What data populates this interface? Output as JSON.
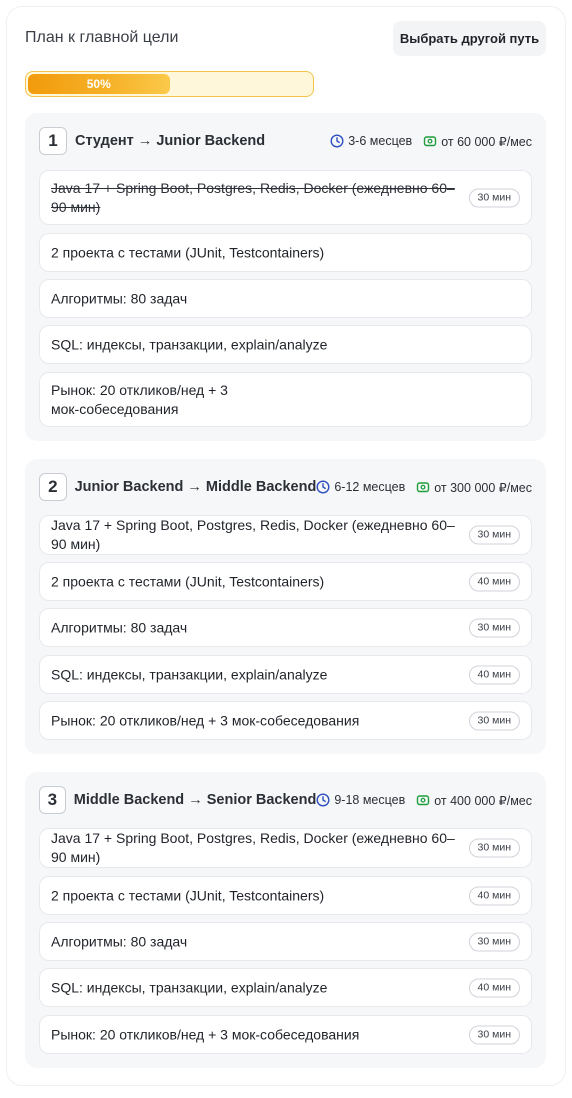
{
  "header": {
    "title": "План к главной цели",
    "choose_path_label": "Выбрать другой путь"
  },
  "progress": {
    "value_percent": 50,
    "label": "50%"
  },
  "colors": {
    "accent": "#f29a0c",
    "clock": "#2f4ec2",
    "money": "#1f9d3a"
  },
  "stages": [
    {
      "number": "1",
      "title": "Студент → Junior Backend",
      "duration": "3-6 месцев",
      "salary": "от 60 000 ₽/мес",
      "tasks": [
        {
          "text": "Java 17 + Spring Boot, Postgres, Redis, Docker (ежедневно 60–90 мин)",
          "time": "30 мин",
          "done": true
        },
        {
          "text": "2 проекта с тестами (JUnit, Testcontainers)",
          "time": "",
          "done": false
        },
        {
          "text": "Алгоритмы: 80 задач",
          "time": "",
          "done": false
        },
        {
          "text": "SQL: индексы, транзакции, explain/analyze",
          "time": "",
          "done": false
        },
        {
          "text": "Рынок: 20 откликов/нед + 3 мок-собеседования",
          "time": "",
          "done": false
        }
      ]
    },
    {
      "number": "2",
      "title": "Junior Backend → Middle Backend",
      "duration": "6-12 месцев",
      "salary": "от 300 000 ₽/мес",
      "tasks": [
        {
          "text": "Java 17 + Spring Boot, Postgres, Redis, Docker (ежедневно 60–90 мин)",
          "time": "30 мин",
          "done": false
        },
        {
          "text": "2 проекта с тестами (JUnit, Testcontainers)",
          "time": "40 мин",
          "done": false
        },
        {
          "text": "Алгоритмы: 80 задач",
          "time": "30 мин",
          "done": false
        },
        {
          "text": "SQL: индексы, транзакции, explain/analyze",
          "time": "40 мин",
          "done": false
        },
        {
          "text": "Рынок: 20 откликов/нед + 3 мок-собеседования",
          "time": "30 мин",
          "done": false
        }
      ]
    },
    {
      "number": "3",
      "title": "Middle Backend → Senior Backend",
      "duration": "9-18 месцев",
      "salary": "от 400 000 ₽/мес",
      "tasks": [
        {
          "text": "Java 17 + Spring Boot, Postgres, Redis, Docker (ежедневно 60–90 мин)",
          "time": "30 мин",
          "done": false
        },
        {
          "text": "2 проекта с тестами (JUnit, Testcontainers)",
          "time": "40 мин",
          "done": false
        },
        {
          "text": "Алгоритмы: 80 задач",
          "time": "30 мин",
          "done": false
        },
        {
          "text": "SQL: индексы, транзакции, explain/analyze",
          "time": "40 мин",
          "done": false
        },
        {
          "text": "Рынок: 20 откликов/нед + 3 мок-собеседования",
          "time": "30 мин",
          "done": false
        }
      ]
    }
  ]
}
